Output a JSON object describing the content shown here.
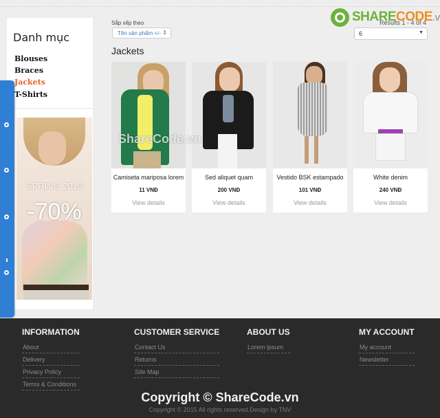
{
  "sidebar": {
    "title": "Danh mục",
    "categories": [
      {
        "label": "Blouses",
        "active": false
      },
      {
        "label": "Braces",
        "active": false
      },
      {
        "label": "Jackets",
        "active": true
      },
      {
        "label": "T-Shirts",
        "active": false
      }
    ],
    "promo": {
      "season": "SPRING 2013",
      "discount": "-70%"
    }
  },
  "sort": {
    "label": "Sắp xếp theo",
    "selected": "Tên sản phẩm +/-",
    "results": "Results 1 - 4 of 4",
    "per_page": "6"
  },
  "logo": {
    "part1": "SHARE",
    "part2": "CODE",
    "part3": ".vn"
  },
  "section_title": "Jackets",
  "products": [
    {
      "name": "Camiseta mariposa lorem",
      "price": "11 VNĐ",
      "view": "View details"
    },
    {
      "name": "Sed aliquet quam",
      "price": "200 VNĐ",
      "view": "View details"
    },
    {
      "name": "Vestido BSK estampado",
      "price": "101 VNĐ",
      "view": "View details"
    },
    {
      "name": "White denim",
      "price": "240 VNĐ",
      "view": "View details"
    }
  ],
  "watermark": "ShareCode.vn",
  "footer": {
    "columns": [
      {
        "heading": "INFORMATION",
        "links": [
          "About",
          "Delivery",
          "Privacy Policy",
          "Terms & Conditions"
        ]
      },
      {
        "heading": "CUSTOMER SERVICE",
        "links": [
          "Contact Us",
          "Returns",
          "Site Map"
        ]
      },
      {
        "heading": "ABOUT US",
        "links": [
          "Lorem ipsum"
        ]
      },
      {
        "heading": "MY ACCOUNT",
        "links": [
          "My account",
          "Newsletter"
        ]
      }
    ],
    "copyright": "Copyright © ShareCode.vn",
    "credits": "Copyright © 2015 All rights reserved.Design by TNV"
  },
  "colors": {
    "accent": "#e8632a",
    "side_tab": "#2f7fd4",
    "footer_bg": "#2a2a2a",
    "logo_green": "#6bb23b",
    "logo_orange": "#f08d1d"
  }
}
